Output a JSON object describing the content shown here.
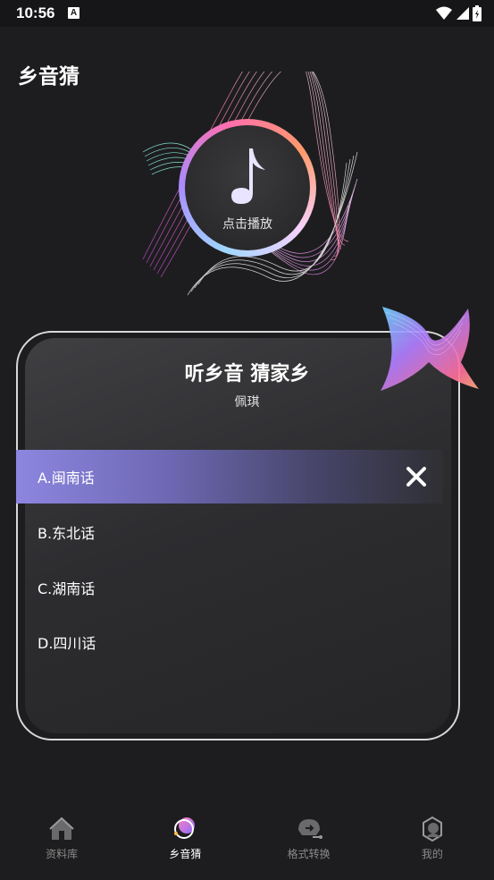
{
  "status": {
    "time": "10:56",
    "notification_badge": "A"
  },
  "header": {
    "title": "乡音猜"
  },
  "player": {
    "play_label": "点击播放"
  },
  "quiz": {
    "title": "听乡音 猜家乡",
    "subtitle": "佩琪",
    "options": [
      {
        "label": "A.闽南话",
        "state": "selected-wrong"
      },
      {
        "label": "B.东北话",
        "state": "normal"
      },
      {
        "label": "C.湖南话",
        "state": "normal"
      },
      {
        "label": "D.四川话",
        "state": "normal"
      }
    ]
  },
  "tabs": [
    {
      "label": "资料库",
      "icon": "library-icon",
      "active": false
    },
    {
      "label": "乡音猜",
      "icon": "guess-icon",
      "active": true
    },
    {
      "label": "格式转换",
      "icon": "convert-icon",
      "active": false
    },
    {
      "label": "我的",
      "icon": "profile-icon",
      "active": false
    }
  ],
  "colors": {
    "background": "#1d1d1f",
    "accent": "#8c86e0",
    "tab_inactive": "#8a8a8a"
  }
}
